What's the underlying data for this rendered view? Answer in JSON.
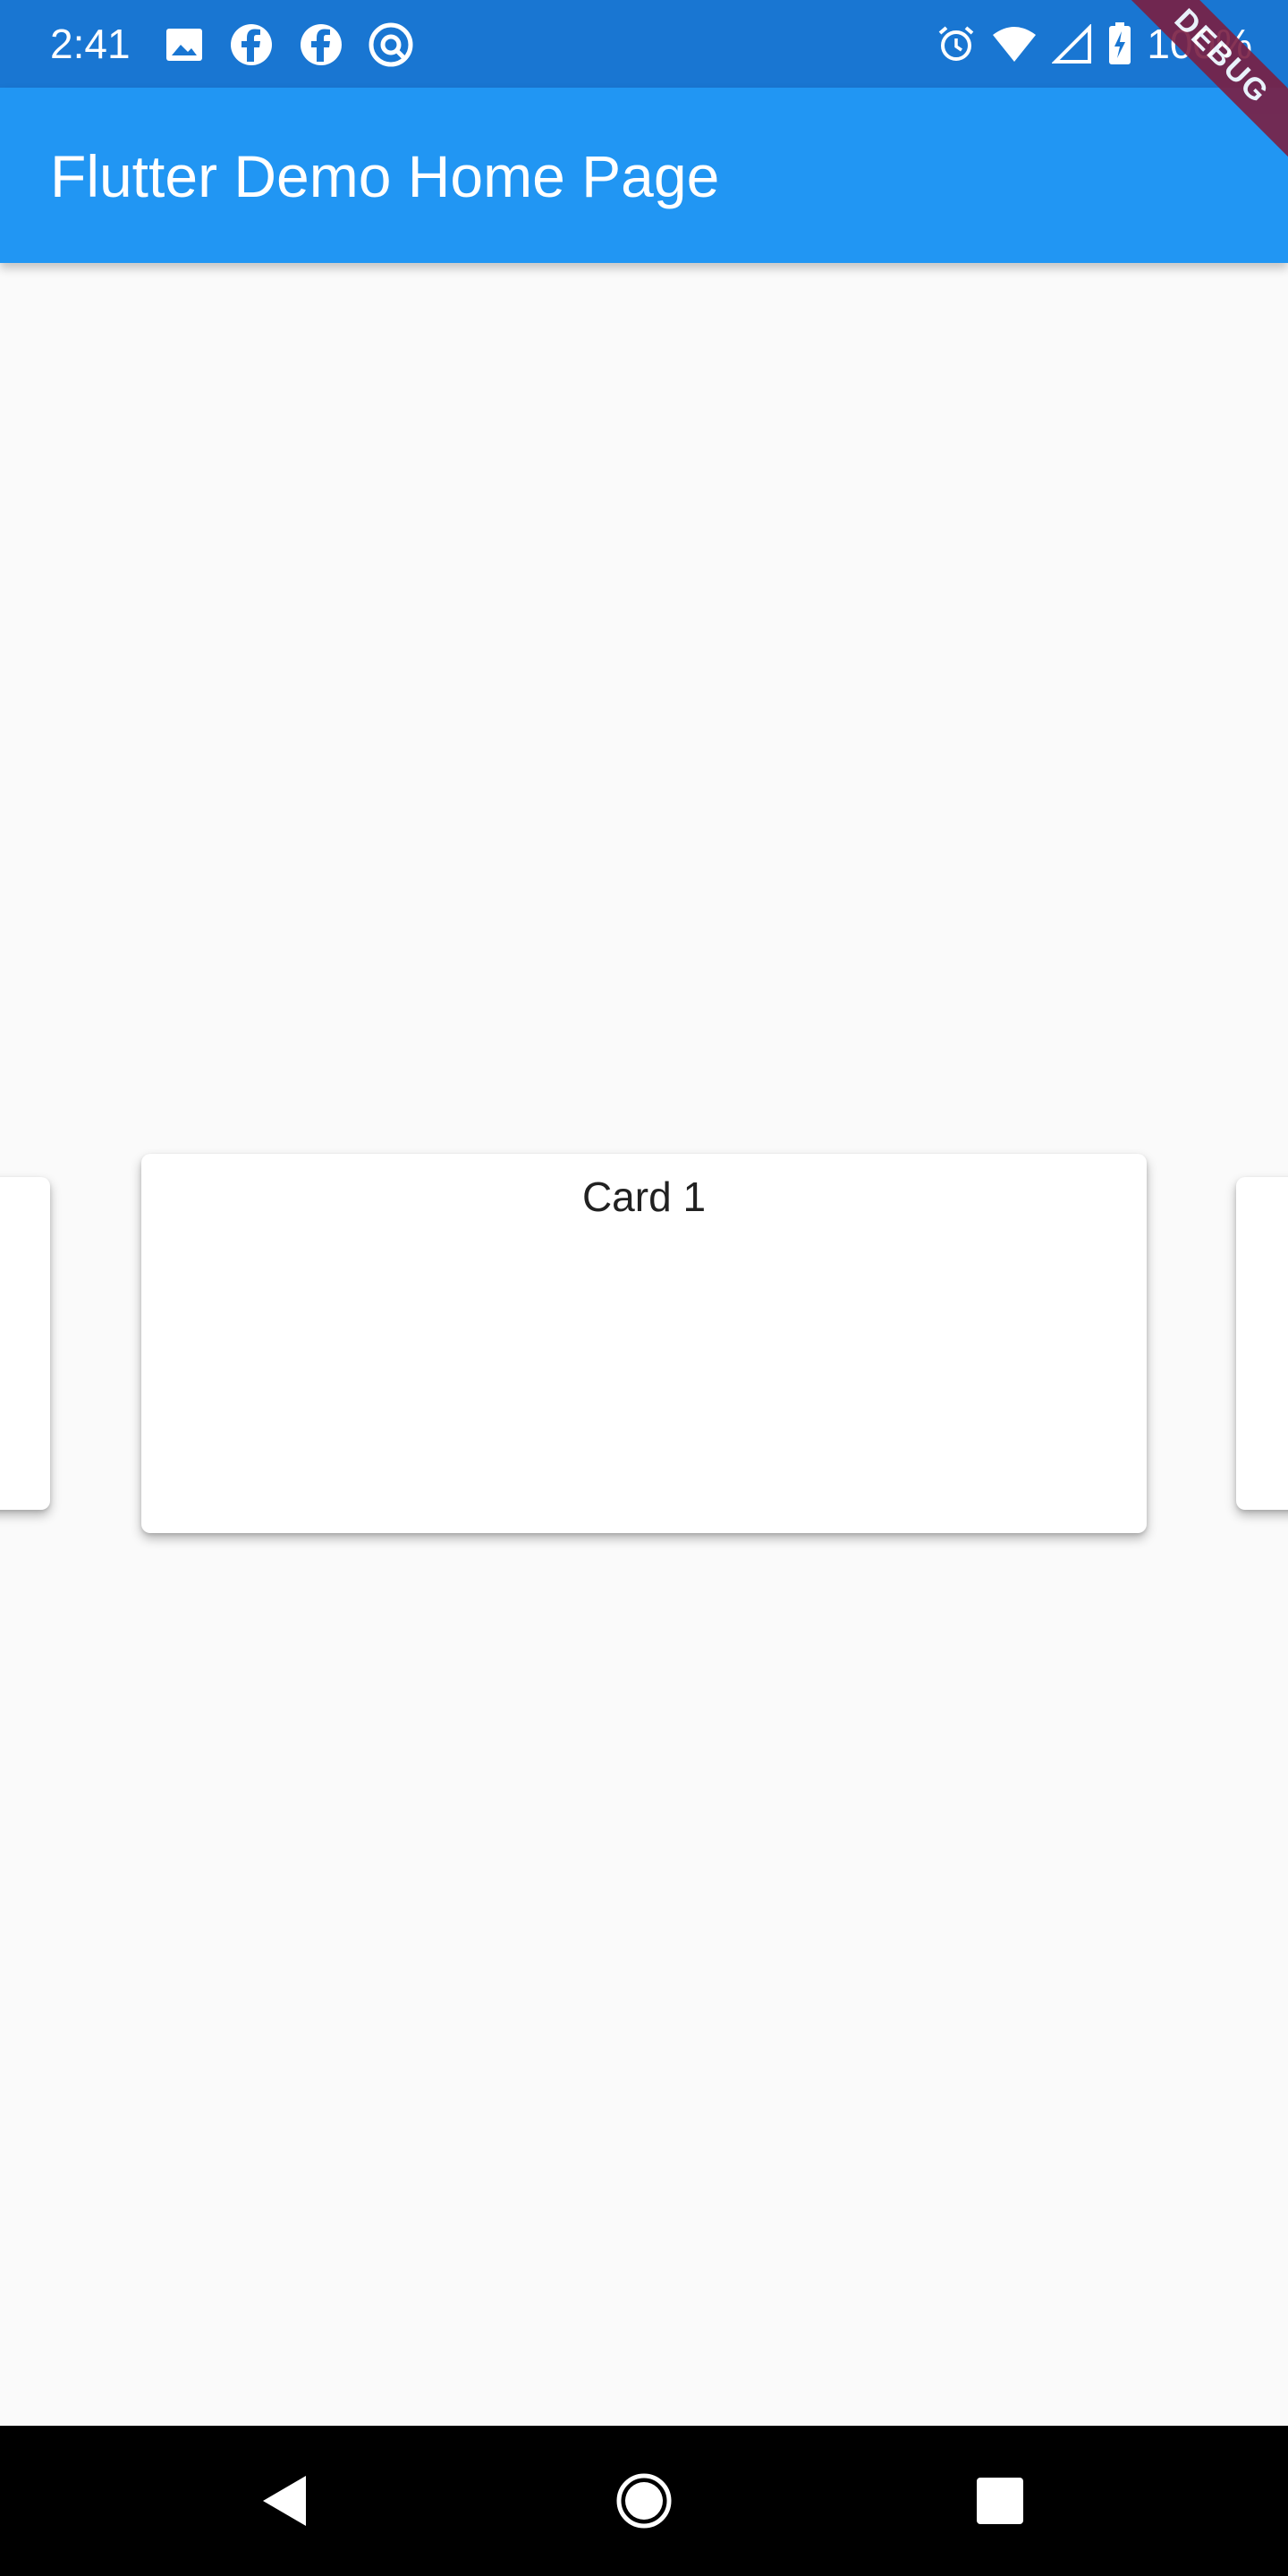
{
  "status_bar": {
    "time": "2:41",
    "battery_text": "100%",
    "left_icons": [
      "image-icon",
      "facebook-icon",
      "facebook-icon",
      "at-sign-icon"
    ],
    "right_icons": [
      "alarm-icon",
      "wifi-icon",
      "cell-signal-icon",
      "battery-charging-icon"
    ],
    "background": "#1976d2"
  },
  "debug_banner": {
    "label": "DEBUG",
    "color": "#7a1f43"
  },
  "app_bar": {
    "title": "Flutter Demo Home Page",
    "background": "#2196f3"
  },
  "carousel": {
    "active_card": {
      "title": "Card 1"
    }
  },
  "nav_bar": {
    "buttons": [
      "back-icon",
      "home-icon",
      "recents-icon"
    ]
  }
}
